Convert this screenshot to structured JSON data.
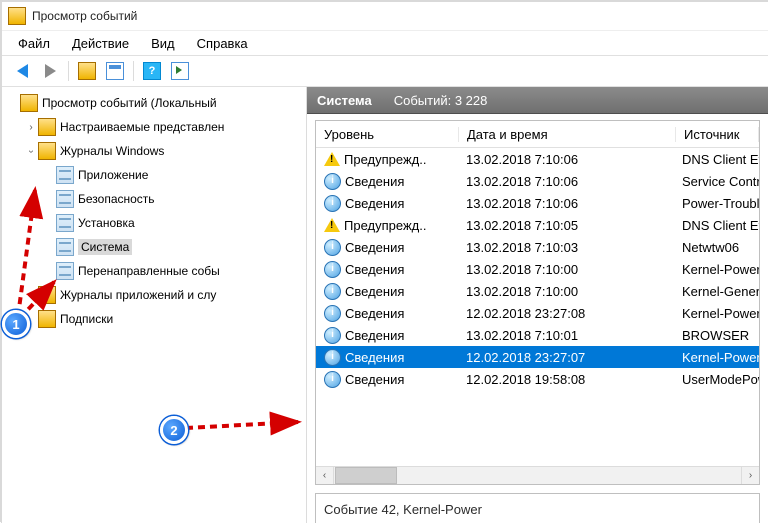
{
  "window": {
    "title": "Просмотр событий"
  },
  "menu": {
    "file": "Файл",
    "action": "Действие",
    "view": "Вид",
    "help": "Справка"
  },
  "tree": {
    "root": "Просмотр событий (Локальный",
    "custom_views": "Настраиваемые представлен",
    "windows_logs": "Журналы Windows",
    "application": "Приложение",
    "security": "Безопасность",
    "setup": "Установка",
    "system": "Система",
    "forwarded": "Перенаправленные собы",
    "apps_services": "Журналы приложений и слу",
    "subscriptions": "Подписки"
  },
  "right": {
    "title": "Система",
    "count_label": "Событий: 3 228",
    "columns": {
      "level": "Уровень",
      "date": "Дата и время",
      "source": "Источник"
    },
    "rows": [
      {
        "icon": "warn",
        "level": "Предупрежд..",
        "date": "13.02.2018 7:10:06",
        "source": "DNS Client Events"
      },
      {
        "icon": "info",
        "level": "Сведения",
        "date": "13.02.2018 7:10:06",
        "source": "Service Control Ma"
      },
      {
        "icon": "info",
        "level": "Сведения",
        "date": "13.02.2018 7:10:06",
        "source": "Power-Troubleshoo"
      },
      {
        "icon": "warn",
        "level": "Предупрежд..",
        "date": "13.02.2018 7:10:05",
        "source": "DNS Client Events"
      },
      {
        "icon": "info",
        "level": "Сведения",
        "date": "13.02.2018 7:10:03",
        "source": "Netwtw06"
      },
      {
        "icon": "info",
        "level": "Сведения",
        "date": "13.02.2018 7:10:00",
        "source": "Kernel-Power"
      },
      {
        "icon": "info",
        "level": "Сведения",
        "date": "13.02.2018 7:10:00",
        "source": "Kernel-General"
      },
      {
        "icon": "info",
        "level": "Сведения",
        "date": "12.02.2018 23:27:08",
        "source": "Kernel-Power"
      },
      {
        "icon": "info",
        "level": "Сведения",
        "date": "13.02.2018 7:10:01",
        "source": "BROWSER"
      },
      {
        "icon": "info",
        "level": "Сведения",
        "date": "12.02.2018 23:27:07",
        "source": "Kernel-Power",
        "selected": true
      },
      {
        "icon": "info",
        "level": "Сведения",
        "date": "12.02.2018 19:58:08",
        "source": "UserModePowerSe"
      }
    ],
    "detail": "Событие 42, Kernel-Power"
  },
  "callouts": {
    "one": "1",
    "two": "2"
  }
}
